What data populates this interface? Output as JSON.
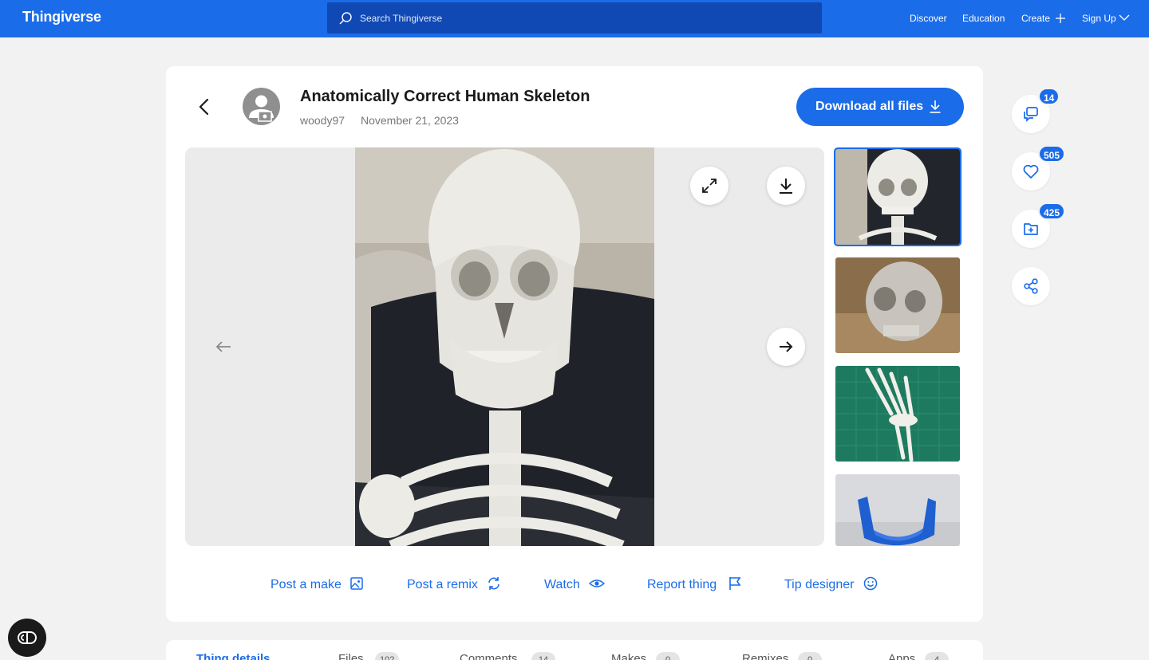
{
  "header": {
    "logo": "Thingiverse",
    "search_placeholder": "Search Thingiverse",
    "nav": {
      "discover": "Discover",
      "education": "Education",
      "create": "Create",
      "signup": "Sign Up"
    }
  },
  "thing": {
    "title": "Anatomically Correct Human Skeleton",
    "author": "woody97",
    "date": "November 21, 2023",
    "download_label": "Download all files"
  },
  "actions": {
    "post_make": "Post a make",
    "post_remix": "Post a remix",
    "watch": "Watch",
    "report": "Report thing",
    "tip": "Tip designer"
  },
  "stats": {
    "comments": "14",
    "likes": "505",
    "collections": "425"
  },
  "tabs": [
    {
      "label": "Thing details",
      "count": ""
    },
    {
      "label": "Files",
      "count": "102"
    },
    {
      "label": "Comments",
      "count": "14"
    },
    {
      "label": "Makes",
      "count": "0"
    },
    {
      "label": "Remixes",
      "count": "0"
    },
    {
      "label": "Apps",
      "count": "4"
    }
  ],
  "colors": {
    "accent": "#1b6ce8",
    "search_bg": "#1048b4",
    "page_bg": "#f2f2f2"
  },
  "icons": [
    "search-icon",
    "plus-icon",
    "chevron-down-icon",
    "back-arrow-icon",
    "download-icon",
    "expand-icon",
    "arrow-left-icon",
    "arrow-right-icon",
    "image-icon",
    "remix-icon",
    "eye-icon",
    "flag-icon",
    "smile-icon",
    "comments-icon",
    "heart-icon",
    "add-folder-icon",
    "share-icon",
    "cookie-settings-icon"
  ]
}
